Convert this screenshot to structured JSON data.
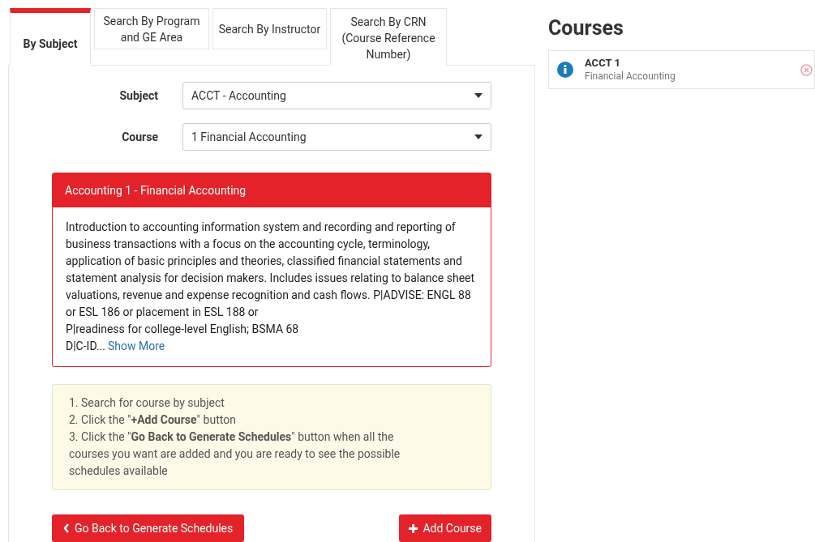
{
  "tabs": [
    {
      "label": "By Subject",
      "selected": true
    },
    {
      "label": "Search By Program and GE Area",
      "selected": false
    },
    {
      "label": "Search By Instructor",
      "selected": false
    },
    {
      "label": "Search By CRN (Course Reference Number)",
      "selected": false
    }
  ],
  "form": [
    {
      "label": "Subject",
      "value": "ACCT - Accounting"
    },
    {
      "label": "Course",
      "value": "1 Financial Accounting"
    }
  ],
  "course_card": {
    "title": "Accounting 1 - Financial Accounting",
    "description_lines": [
      "Introduction to accounting information system and recording and reporting of business transactions with a focus on the accounting cycle, terminology, application of basic principles and theories, classified financial statements and statement analysis for decision makers. Includes issues relating to balance sheet valuations, revenue and expense recognition and cash flows. P|ADVISE: ENGL 88 or ESL 186 or placement in ESL 188 or",
      "P|readiness for college-level English; BSMA 68"
    ],
    "last_line": "D|C-ID...",
    "show_more": "Show More"
  },
  "instructions": [
    "1. Search for course by subject",
    "2. Click the \"**+Add Course**\" button",
    "3. Click the \"**Go Back to Generate Schedules**\" button when all the courses you want are added and you are ready to see the possible schedules available"
  ],
  "buttons": {
    "back": "Go Back to Generate Schedules",
    "add": "Add Course"
  },
  "courses": {
    "title": "Courses",
    "items": [
      {
        "code": "ACCT 1",
        "name": "Financial Accounting"
      }
    ]
  }
}
